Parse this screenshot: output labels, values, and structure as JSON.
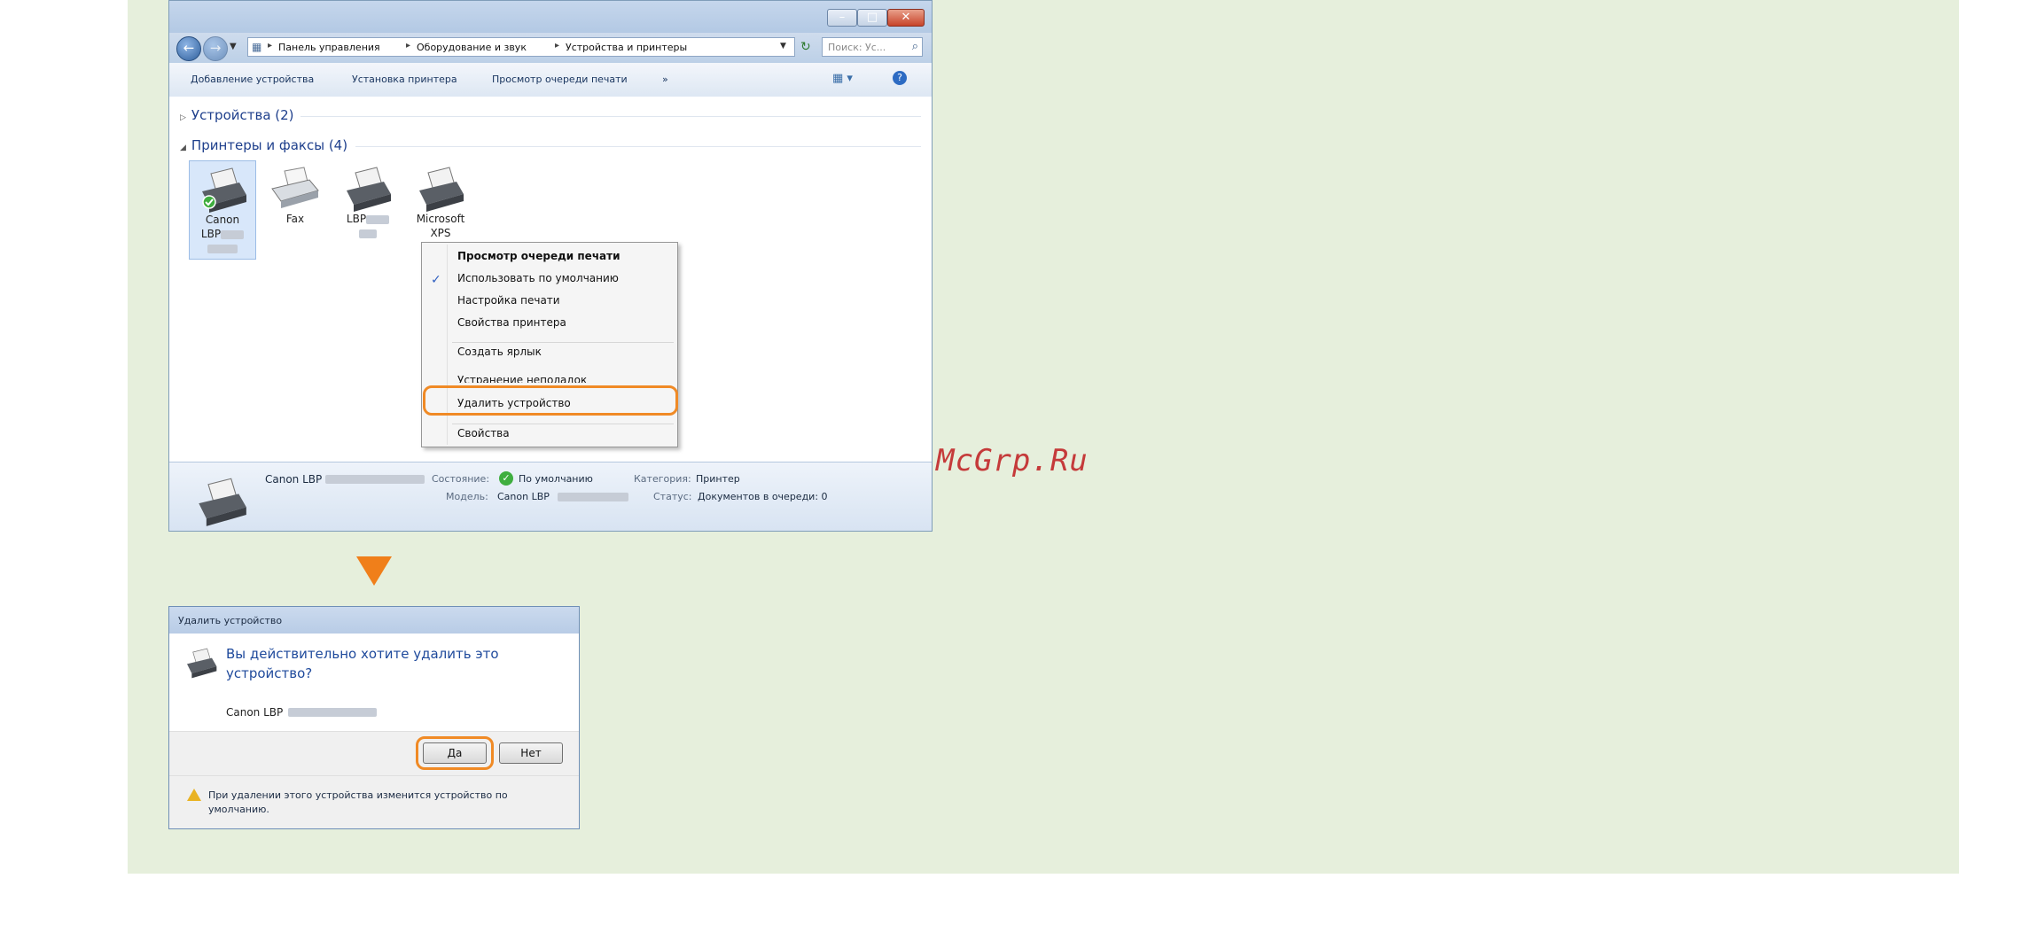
{
  "window": {
    "breadcrumb": [
      "Панель управления",
      "Оборудование и звук",
      "Устройства и принтеры"
    ],
    "search_placeholder": "Поиск: Ус...",
    "toolbar": [
      "Добавление устройства",
      "Установка принтера",
      "Просмотр очереди печати",
      "»"
    ],
    "groups": [
      {
        "label": "Устройства (2)",
        "expanded": false
      },
      {
        "label": "Принтеры и факсы (4)",
        "expanded": true
      }
    ],
    "devices": [
      {
        "line1": "Canon",
        "line2": "LBP",
        "selected": true,
        "default": true
      },
      {
        "line1": "Fax",
        "line2": "",
        "selected": false
      },
      {
        "line1": "LBP",
        "line2": "",
        "selected": false
      },
      {
        "line1": "Microsoft",
        "line2": "XPS",
        "selected": false
      }
    ],
    "context_menu": [
      "Просмотр очереди печати",
      "Использовать по умолчанию",
      "Настройка печати",
      "Свойства принтера",
      "Создать ярлык",
      "Устранение неполадок",
      "Удалить устройство",
      "Свойства"
    ],
    "details": {
      "name": "Canon LBP",
      "state_label": "Состояние:",
      "state_value": "По умолчанию",
      "category_label": "Категория:",
      "category_value": "Принтер",
      "model_label": "Модель:",
      "model_value": "Canon LBP",
      "status_label": "Статус:",
      "status_value": "Документов в очереди: 0"
    }
  },
  "dialog": {
    "title": "Удалить устройство",
    "question": "Вы действительно хотите удалить это устройство?",
    "device": "Canon LBP",
    "yes": "Да",
    "no": "Нет",
    "note": "При удалении этого устройства изменится устройство по умолчанию."
  },
  "watermark": "McGrp.Ru",
  "colors": {
    "highlight": "#f08a25",
    "panel_bg": "#e6efdc",
    "link_blue": "#1f4a9c"
  }
}
